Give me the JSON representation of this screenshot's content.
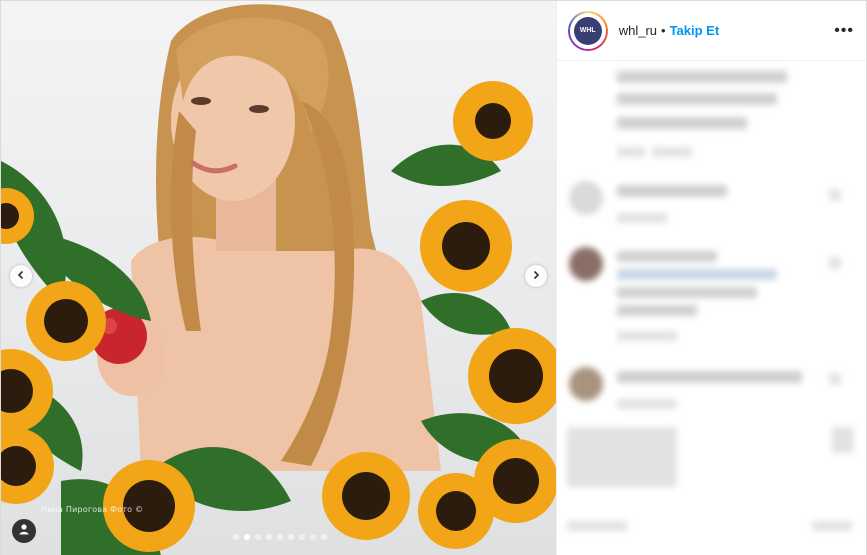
{
  "post": {
    "username": "whl_ru",
    "separator": "•",
    "follow_label": "Takip Et",
    "more_label": "•••",
    "avatar_text": "WHL"
  },
  "media": {
    "credit_text": "Нина Пирогова Фото ©",
    "carousel": {
      "count": 9,
      "active_index": 1
    }
  },
  "colors": {
    "accent": "#0095f6",
    "text": "#262626",
    "border": "#dbdbdb"
  },
  "icons": {
    "prev": "chevron-left-icon",
    "next": "chevron-right-icon",
    "tags": "user-tag-icon",
    "more": "more-options-icon"
  }
}
